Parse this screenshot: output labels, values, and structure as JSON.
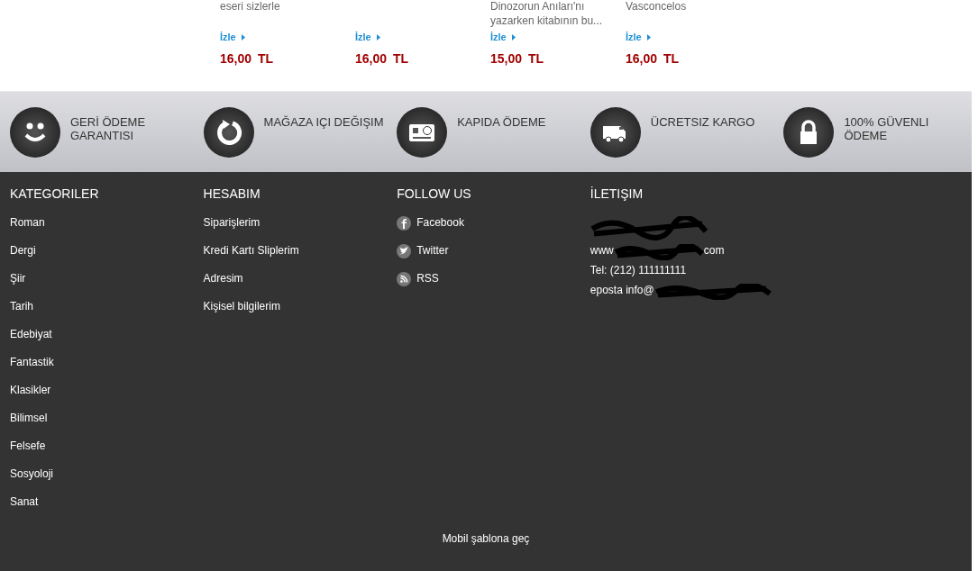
{
  "products": [
    {
      "description": "eseri sizlerle",
      "link": "İzle",
      "price": "16,00 TL"
    },
    {
      "link": "İzle",
      "price": "16,00 TL"
    },
    {
      "description": "Dinozorun Anıları'nı yazarken kitabının bu...",
      "link": "İzle",
      "price": "15,00 TL"
    },
    {
      "description": "Vasconcelos",
      "link": "İzle",
      "price": "16,00 TL"
    }
  ],
  "features": [
    {
      "kind": "smile",
      "label": "GERİ ÖDEME GARANTISI"
    },
    {
      "kind": "refresh",
      "label": "MAĞAZA IÇI DEĞIŞIM"
    },
    {
      "kind": "card",
      "label": "KAPIDA ÖDEME"
    },
    {
      "kind": "truck",
      "label": "ÜCRETSIZ KARGO"
    },
    {
      "kind": "lock",
      "label": "100% GÜVENLI ÖDEME"
    }
  ],
  "footer": {
    "categories": {
      "title": "KATEGORILER",
      "items": [
        "Roman",
        "Dergi",
        "Şiir",
        "Tarih",
        "Edebiyat",
        "Fantastik",
        "Klasikler",
        "Bilimsel",
        "Felsefe",
        "Sosyoloji",
        "Sanat"
      ]
    },
    "account": {
      "title": "HESABIM",
      "items": [
        "Siparişlerim",
        "Kredi Kartı Sliplerim",
        "Adresim",
        "Kişisel bilgilerim"
      ]
    },
    "follow": {
      "title": "FOLLOW US",
      "items": [
        {
          "kind": "facebook",
          "label": "Facebook"
        },
        {
          "kind": "twitter",
          "label": "Twitter"
        },
        {
          "kind": "rss",
          "label": "RSS"
        }
      ]
    },
    "contact": {
      "title": "İLETIŞIM",
      "lines": [
        {
          "kind": "redacted"
        },
        {
          "kind": "text",
          "prefix": "www",
          "suffix": "com"
        },
        {
          "kind": "text",
          "prefix": "Tel: (212) 111111111"
        },
        {
          "kind": "text",
          "prefix": "eposta info@",
          "redacted": true
        }
      ]
    },
    "mobile_link": "Mobil şablona geç"
  }
}
